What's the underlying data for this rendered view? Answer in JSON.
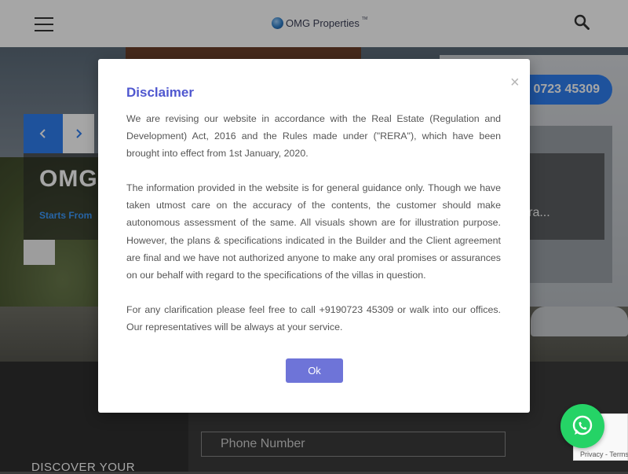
{
  "header": {
    "logo_text": "OMG Properties",
    "logo_tm": "TM",
    "icons": {
      "menu": "hamburger-icon",
      "search": "search-icon",
      "logo": "globe-icon"
    }
  },
  "hero": {
    "title": "OMG",
    "subtitle": "Starts From",
    "right_text": "mpara...",
    "phone_partial": "0723 45309",
    "prev_icon": "chevron-left-icon",
    "next_icon": "chevron-right-icon"
  },
  "modal": {
    "title": "Disclaimer",
    "close_symbol": "×",
    "paragraphs": [
      "We are revising our website in accordance with the Real Estate (Regulation and Development) Act, 2016 and the Rules made under (\"RERA\"), which have been brought into effect from 1st January, 2020.",
      "The information provided in the website is for general guidance only. Though we have taken utmost care on the accuracy of the contents, the customer should make autonomous assessment of the same. All visuals shown are for illustration purpose. However, the plans & specifications indicated in the Builder and the Client agreement are final and we have not authorized anyone to make any oral promises or assurances on our behalf with regard to the specifications of the villas in question.",
      "For any clarification please feel free to call +9190723 45309 or walk into our offices. Our representatives will be always at your service."
    ],
    "ok_label": "Ok"
  },
  "form": {
    "phone_placeholder": "Phone Number",
    "discover_text": "DISCOVER YOUR"
  },
  "recaptcha": {
    "links": "Privacy - Terms"
  },
  "colors": {
    "accent": "#2f7ff0",
    "modal_title": "#4f57cf",
    "ok_button": "#6e74d8",
    "whatsapp": "#25d366"
  }
}
